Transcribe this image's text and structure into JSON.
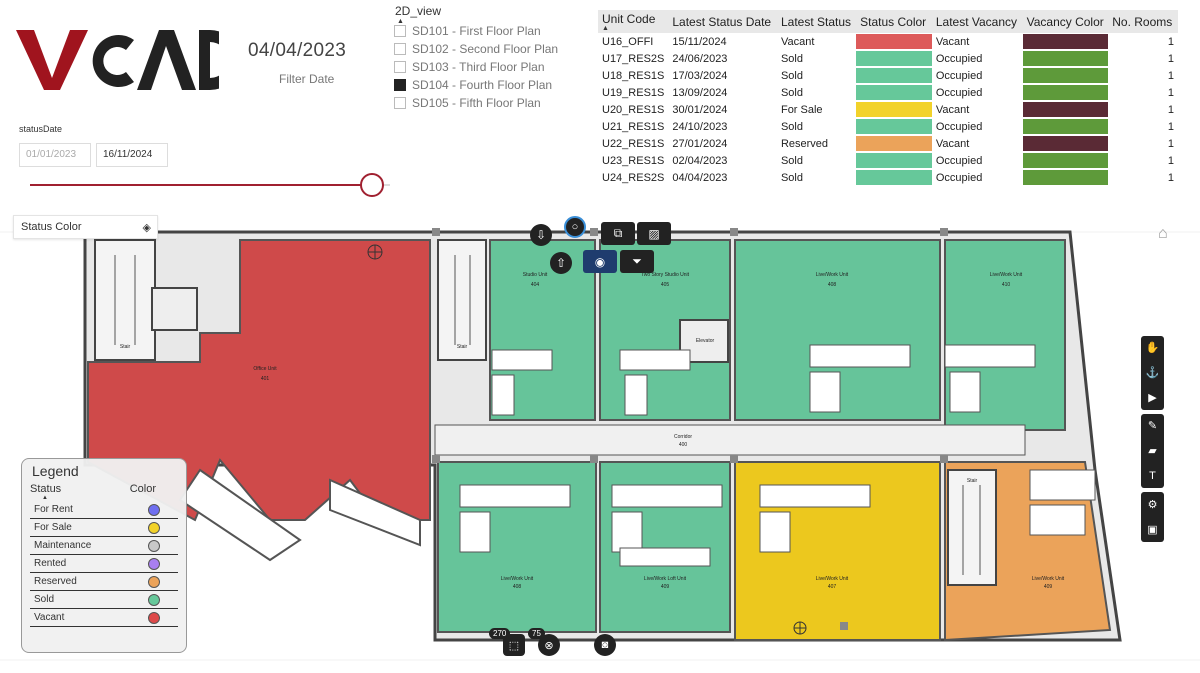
{
  "brand": {
    "logo_text": "VCAD",
    "logo_red": "#a0141e",
    "logo_dark": "#222222"
  },
  "filter": {
    "date": "04/04/2023",
    "label": "Filter Date"
  },
  "status_date": {
    "label": "statusDate",
    "start": "01/01/2023",
    "end": "16/11/2024",
    "slider_position": 0.95,
    "slider_color": "#a02030"
  },
  "view": {
    "title": "2D_view",
    "options": [
      {
        "label": "SD101 - First Floor Plan",
        "checked": false
      },
      {
        "label": "SD102 - Second Floor Plan",
        "checked": false
      },
      {
        "label": "SD103 - Third Floor Plan",
        "checked": false
      },
      {
        "label": "SD104 - Fourth Floor Plan",
        "checked": true
      },
      {
        "label": "SD105 - Fifth Floor Plan",
        "checked": false
      }
    ]
  },
  "table": {
    "sort_indicator": "▲",
    "headers": [
      "Unit Code",
      "Latest Status Date",
      "Latest Status",
      "Status Color",
      "Latest Vacancy",
      "Vacancy Color",
      "No. Rooms"
    ],
    "rows": [
      {
        "code": "U16_OFFI",
        "date": "15/11/2024",
        "status": "Vacant",
        "status_color": "#dd5a5a",
        "vacancy": "Vacant",
        "vacancy_color": "#5a2a35",
        "rooms": "1"
      },
      {
        "code": "U17_RES2S",
        "date": "24/06/2023",
        "status": "Sold",
        "status_color": "#66c89a",
        "vacancy": "Occupied",
        "vacancy_color": "#5e9a3a",
        "rooms": "1"
      },
      {
        "code": "U18_RES1S",
        "date": "17/03/2024",
        "status": "Sold",
        "status_color": "#66c89a",
        "vacancy": "Occupied",
        "vacancy_color": "#5e9a3a",
        "rooms": "1"
      },
      {
        "code": "U19_RES1S",
        "date": "13/09/2024",
        "status": "Sold",
        "status_color": "#66c89a",
        "vacancy": "Occupied",
        "vacancy_color": "#5e9a3a",
        "rooms": "1"
      },
      {
        "code": "U20_RES1S",
        "date": "30/01/2024",
        "status": "For Sale",
        "status_color": "#f2d22a",
        "vacancy": "Vacant",
        "vacancy_color": "#5a2a35",
        "rooms": "1"
      },
      {
        "code": "U21_RES1S",
        "date": "24/10/2023",
        "status": "Sold",
        "status_color": "#66c89a",
        "vacancy": "Occupied",
        "vacancy_color": "#5e9a3a",
        "rooms": "1"
      },
      {
        "code": "U22_RES1S",
        "date": "27/01/2024",
        "status": "Reserved",
        "status_color": "#eba35a",
        "vacancy": "Vacant",
        "vacancy_color": "#5a2a35",
        "rooms": "1"
      },
      {
        "code": "U23_RES1S",
        "date": "02/04/2023",
        "status": "Sold",
        "status_color": "#66c89a",
        "vacancy": "Occupied",
        "vacancy_color": "#5e9a3a",
        "rooms": "1"
      },
      {
        "code": "U24_RES2S",
        "date": "04/04/2023",
        "status": "Sold",
        "status_color": "#66c89a",
        "vacancy": "Occupied",
        "vacancy_color": "#5e9a3a",
        "rooms": "1"
      }
    ]
  },
  "status_dropdown": {
    "label": "Status Color",
    "icon": "layers-icon"
  },
  "plan": {
    "units": [
      {
        "label": "Office Unit",
        "num": "401",
        "color": "#cf4a4a"
      },
      {
        "label": "Studio Unit",
        "num": "404",
        "color": "#66c49a"
      },
      {
        "label": "Two Story Studio Unit",
        "num": "405",
        "color": "#66c49a"
      },
      {
        "label": "Live/Work Unit",
        "num": "408",
        "color": "#66c49a"
      },
      {
        "label": "Live/Work Unit",
        "num": "410",
        "color": "#66c49a"
      },
      {
        "label": "Live/Work Unit",
        "num": "408",
        "color": "#66c49a"
      },
      {
        "label": "Live/Work Loft Unit",
        "num": "409",
        "color": "#66c49a"
      },
      {
        "label": "Live/Work Unit",
        "num": "407",
        "color": "#ecc81e"
      },
      {
        "label": "Live/Work Unit",
        "num": "409",
        "color": "#eba35a"
      }
    ],
    "rooms": {
      "elevator": "Elevator",
      "stair": "Stair",
      "corridor": "Corridor",
      "corridor_num": "400"
    },
    "counts": {
      "selected": "270",
      "filtered": "75"
    }
  },
  "legend": {
    "title": "Legend",
    "col_status": "Status",
    "col_color": "Color",
    "items": [
      {
        "label": "For Rent",
        "color": "#6f6ff0"
      },
      {
        "label": "For Sale",
        "color": "#f2d22a"
      },
      {
        "label": "Maintenance",
        "color": "#c8c8c8"
      },
      {
        "label": "Rented",
        "color": "#a97ff0"
      },
      {
        "label": "Reserved",
        "color": "#eba35a"
      },
      {
        "label": "Sold",
        "color": "#66c89a"
      },
      {
        "label": "Vacant",
        "color": "#dd4a4a"
      }
    ]
  }
}
